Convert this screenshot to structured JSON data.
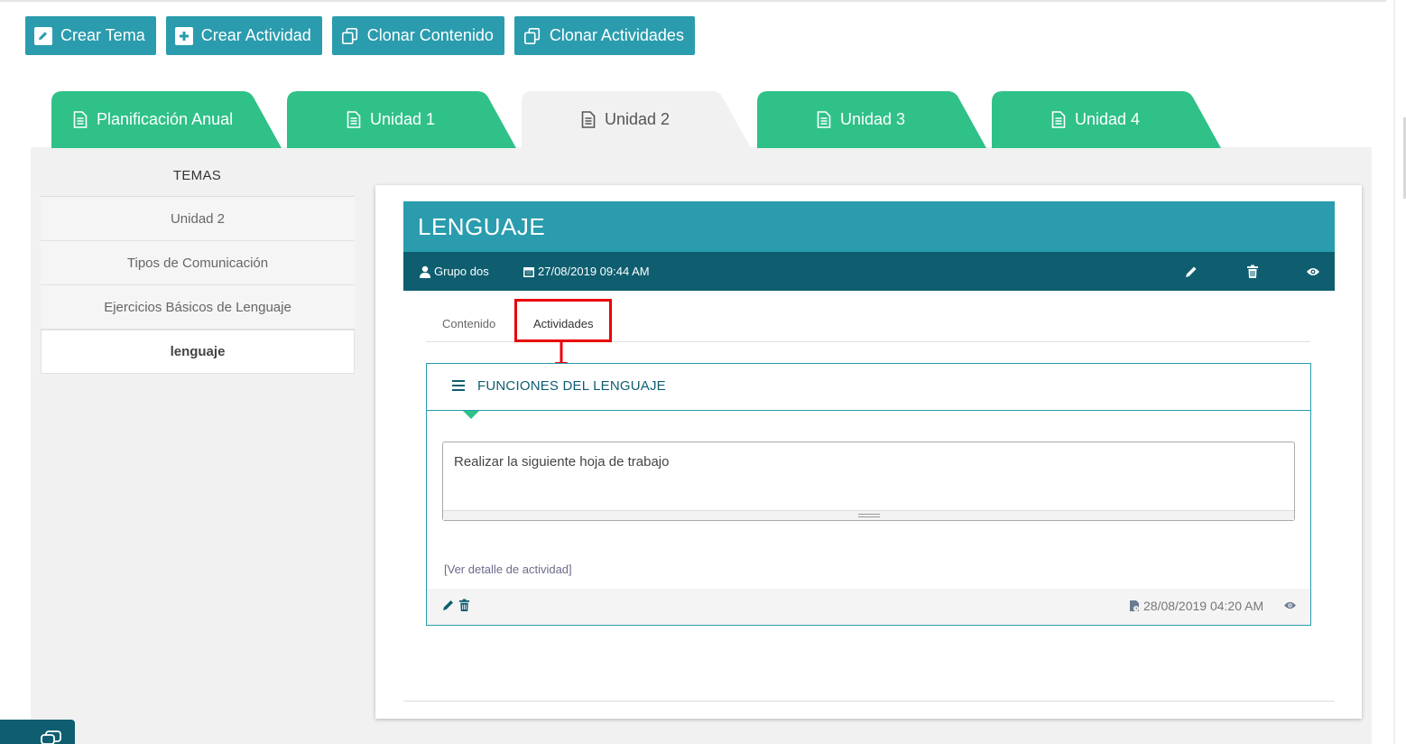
{
  "toolbar": {
    "crear_tema": "Crear Tema",
    "crear_actividad": "Crear Actividad",
    "clonar_contenido": "Clonar Contenido",
    "clonar_actividades": "Clonar Actividades"
  },
  "tabs": [
    {
      "label": "Planificación Anual"
    },
    {
      "label": "Unidad 1"
    },
    {
      "label": "Unidad 2"
    },
    {
      "label": "Unidad 3"
    },
    {
      "label": "Unidad 4"
    }
  ],
  "sidebar": {
    "heading": "TEMAS",
    "items": [
      {
        "label": "Unidad 2"
      },
      {
        "label": "Tipos de Comunicación"
      },
      {
        "label": "Ejercicios Básicos de Lenguaje"
      },
      {
        "label": "lenguaje"
      }
    ]
  },
  "topic": {
    "title": "LENGUAJE",
    "group": "Grupo dos",
    "datetime": "27/08/2019 09:44 AM"
  },
  "inner_tabs": {
    "contenido": "Contenido",
    "actividades": "Actividades"
  },
  "activity": {
    "title": "FUNCIONES DEL LENGUAJE",
    "description": "Realizar la siguiente hoja de trabajo",
    "detail_link": "[Ver detalle de actividad]",
    "datetime": "28/08/2019 04:20 AM"
  },
  "colors": {
    "toolbar_button": "#2a9cae",
    "tab_green": "#2fc188",
    "header_teal": "#2a9cae",
    "subheader_dark": "#0e5e70",
    "highlight_red": "#e8000b"
  }
}
